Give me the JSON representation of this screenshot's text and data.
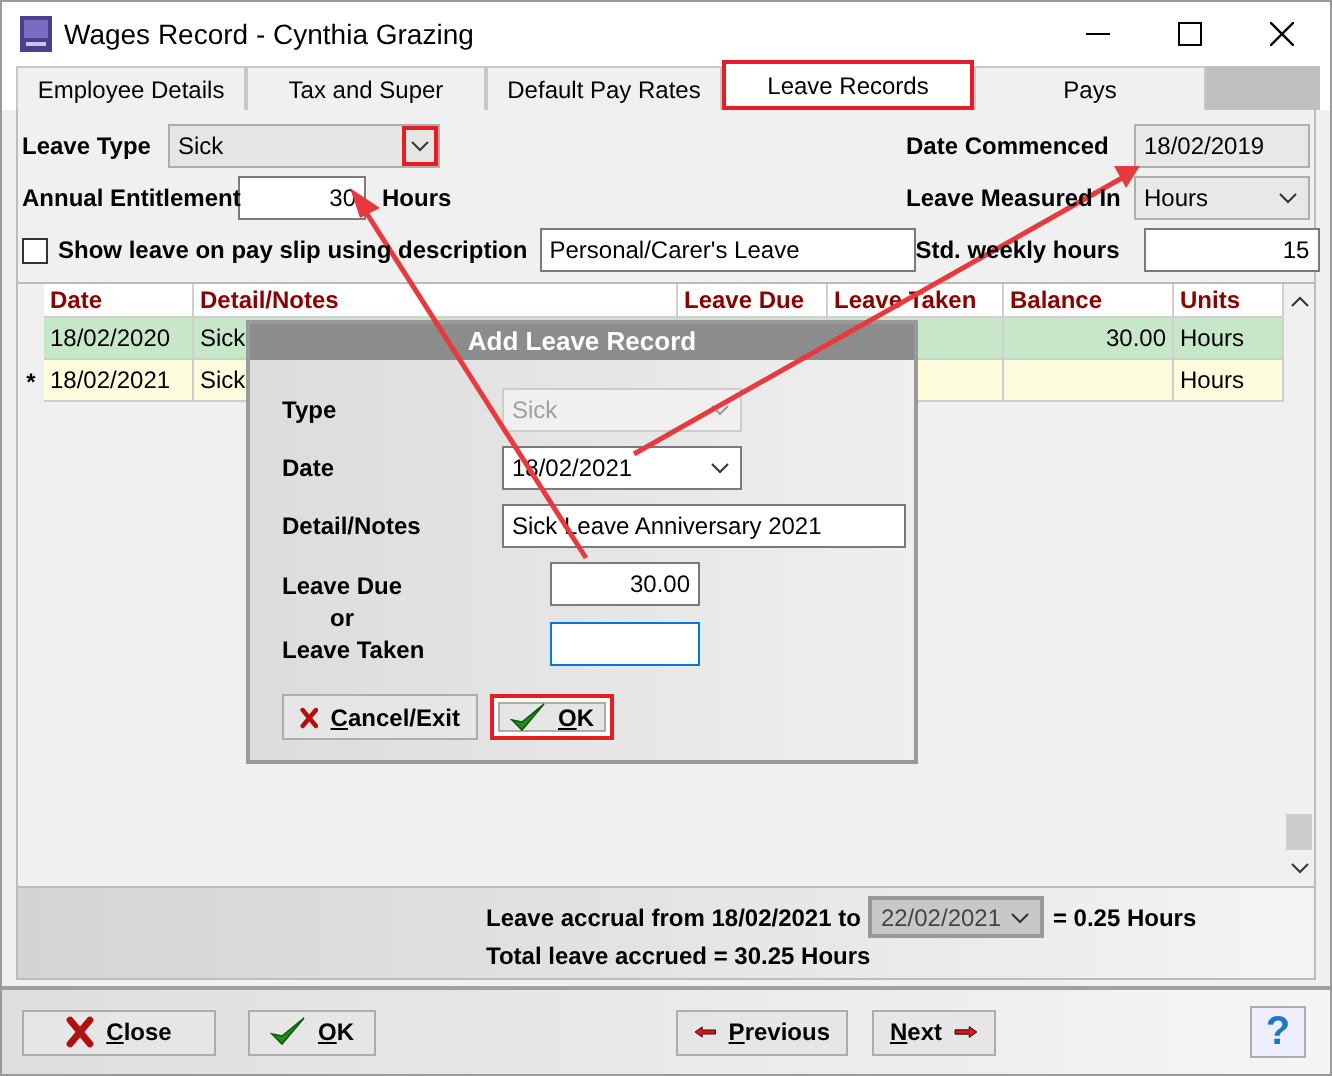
{
  "window": {
    "title": "Wages Record - Cynthia Grazing"
  },
  "tabs": [
    {
      "label": "Employee Details",
      "selected": false,
      "annotated": false
    },
    {
      "label": "Tax and Super",
      "selected": false,
      "annotated": false
    },
    {
      "label": "Default Pay Rates",
      "selected": false,
      "annotated": false
    },
    {
      "label": "Leave Records",
      "selected": true,
      "annotated": true
    },
    {
      "label": "Pays",
      "selected": false,
      "annotated": false
    }
  ],
  "leave_type": {
    "label": "Leave Type",
    "value": "Sick",
    "annotated": true
  },
  "date_commenced": {
    "label": "Date Commenced",
    "value": "18/02/2019"
  },
  "annual_entitlement": {
    "label": "Annual Entitlement",
    "value": "30",
    "unit": "Hours"
  },
  "leave_measured_in": {
    "label": "Leave Measured In",
    "value": "Hours"
  },
  "show_on_payslip": {
    "label": "Show leave on pay slip using description",
    "checked": false,
    "description": "Personal/Carer's Leave"
  },
  "std_weekly_hours": {
    "label": "Std. weekly hours",
    "value": "15"
  },
  "table": {
    "columns": [
      "Date",
      "Detail/Notes",
      "Leave Due",
      "Leave Taken",
      "Balance",
      "Units"
    ],
    "rows": [
      {
        "kind": "existing",
        "date": "18/02/2020",
        "detail": "Sick",
        "balance": "30.00",
        "units": "Hours"
      },
      {
        "kind": "new",
        "marker": "*",
        "date": "18/02/2021",
        "detail": "Sick",
        "units": "Hours"
      }
    ]
  },
  "dialog": {
    "title": "Add Leave Record",
    "type": {
      "label": "Type",
      "value": "Sick",
      "disabled": true
    },
    "date": {
      "label": "Date",
      "value": "18/02/2021"
    },
    "detail": {
      "label": "Detail/Notes",
      "value": "Sick Leave Anniversary 2021"
    },
    "leave_due": {
      "label": "Leave Due",
      "value": "30.00"
    },
    "or_text": "or",
    "leave_taken": {
      "label": "Leave Taken",
      "focused": true
    },
    "buttons": [
      {
        "label": "Cancel/Exit",
        "kind": "cancel",
        "annotated": false
      },
      {
        "label": "OK",
        "kind": "ok",
        "annotated": true
      }
    ]
  },
  "accrual": {
    "prefix": "Leave accrual from 18/02/2021 to",
    "to_date": "22/02/2021",
    "result": "= 0.25 Hours",
    "total": "Total leave accrued = 30.25 Hours"
  },
  "buttons": [
    {
      "label": "Close",
      "kind": "close"
    },
    {
      "label": "OK",
      "kind": "ok"
    },
    {
      "label": "Previous",
      "kind": "previous"
    },
    {
      "label": "Next",
      "kind": "next"
    }
  ],
  "help_button": {
    "label": "?"
  }
}
